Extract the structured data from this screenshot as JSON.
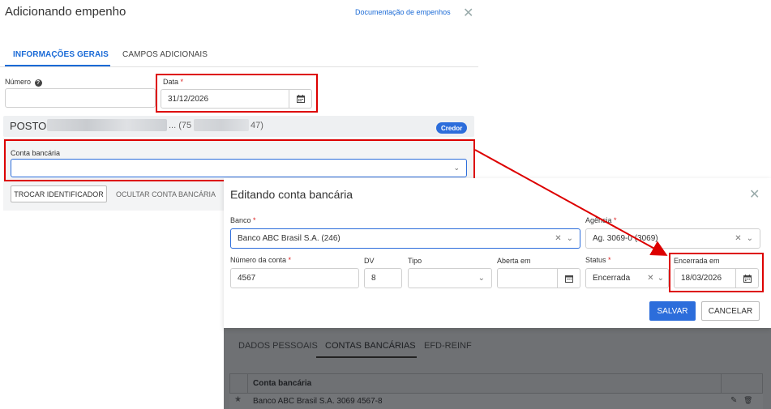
{
  "main": {
    "title": "Adicionando empenho",
    "doc_link": "Documentação de empenhos",
    "close": "✕",
    "tabs": [
      "INFORMAÇÕES GERAIS",
      "CAMPOS ADICIONAIS"
    ],
    "numero_label": "Número",
    "help_icon": "?",
    "data_label": "Data",
    "data_value": "31/12/2026",
    "posto_name": "POSTO",
    "posto_suffix": "... (75",
    "posto_suffix2": "47)",
    "credor_badge": "Credor",
    "conta_label": "Conta bancária",
    "btn_trocar": "TROCAR IDENTIFICADOR",
    "btn_ocultar": "OCULTAR CONTA BANCÁRIA"
  },
  "modal": {
    "title": "Editando conta bancária",
    "close": "✕",
    "banco_label": "Banco",
    "banco_value": "Banco ABC Brasil S.A. (246)",
    "agencia_label": "Agência",
    "agencia_value": "Ag. 3069-0 (3069)",
    "numero_conta_label": "Número da conta",
    "numero_conta_value": "4567",
    "dv_label": "DV",
    "dv_value": "8",
    "tipo_label": "Tipo",
    "aberta_label": "Aberta em",
    "status_label": "Status",
    "status_value": "Encerrada",
    "encerrada_label": "Encerrada em",
    "encerrada_value": "18/03/2026",
    "btn_salvar": "SALVAR",
    "btn_cancelar": "CANCELAR"
  },
  "background": {
    "tabs": [
      "DADOS PESSOAIS",
      "CONTAS BANCÁRIAS",
      "EFD-REINF"
    ],
    "table_header": "Conta bancária",
    "table_row": "Banco ABC Brasil S.A. 3069 4567-8"
  },
  "icons": {
    "calendar": "calendar-icon",
    "clear": "clear-icon",
    "chevron": "chevron-down-icon",
    "star": "star-icon",
    "edit": "edit-icon",
    "delete": "trash-icon"
  },
  "colors": {
    "accent": "#2c6ddb",
    "annotation": "#dd0000"
  }
}
